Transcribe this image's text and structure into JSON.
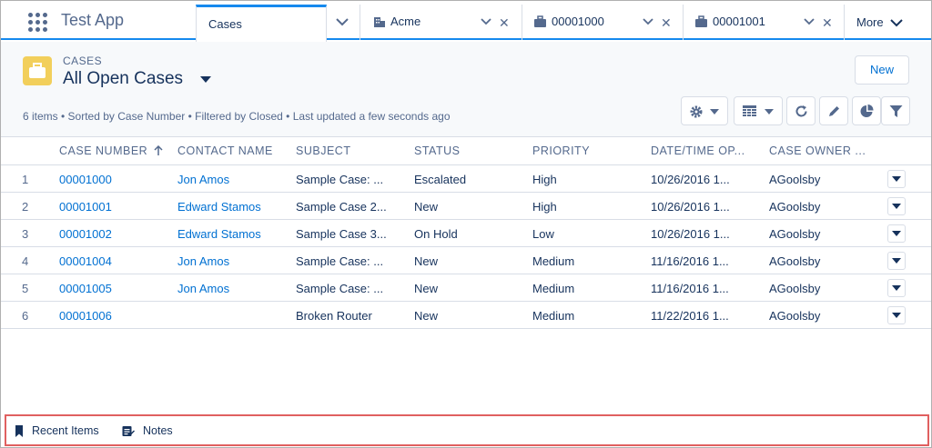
{
  "app": {
    "name": "Test App"
  },
  "tabs": [
    {
      "label": "Cases"
    },
    {
      "label": "Acme"
    },
    {
      "label": "00001000"
    },
    {
      "label": "00001001"
    }
  ],
  "more_label": "More",
  "header": {
    "object_label": "CASES",
    "list_view": "All Open Cases",
    "new_button": "New",
    "meta": "6 items • Sorted by Case Number • Filtered by Closed • Last updated a few seconds ago"
  },
  "table": {
    "columns": [
      "CASE NUMBER",
      "CONTACT NAME",
      "SUBJECT",
      "STATUS",
      "PRIORITY",
      "DATE/TIME OP...",
      "CASE OWNER ..."
    ],
    "rows": [
      {
        "num": "1",
        "case": "00001000",
        "contact": "Jon Amos",
        "subject": "Sample Case: ...",
        "status": "Escalated",
        "priority": "High",
        "date": "10/26/2016 1...",
        "owner": "AGoolsby"
      },
      {
        "num": "2",
        "case": "00001001",
        "contact": "Edward Stamos",
        "subject": "Sample Case 2...",
        "status": "New",
        "priority": "High",
        "date": "10/26/2016 1...",
        "owner": "AGoolsby"
      },
      {
        "num": "3",
        "case": "00001002",
        "contact": "Edward Stamos",
        "subject": "Sample Case 3...",
        "status": "On Hold",
        "priority": "Low",
        "date": "10/26/2016 1...",
        "owner": "AGoolsby"
      },
      {
        "num": "4",
        "case": "00001004",
        "contact": "Jon Amos",
        "subject": "Sample Case: ...",
        "status": "New",
        "priority": "Medium",
        "date": "11/16/2016 1...",
        "owner": "AGoolsby"
      },
      {
        "num": "5",
        "case": "00001005",
        "contact": "Jon Amos",
        "subject": "Sample Case: ...",
        "status": "New",
        "priority": "Medium",
        "date": "11/16/2016 1...",
        "owner": "AGoolsby"
      },
      {
        "num": "6",
        "case": "00001006",
        "contact": "",
        "subject": "Broken Router",
        "status": "New",
        "priority": "Medium",
        "date": "11/22/2016 1...",
        "owner": "AGoolsby"
      }
    ]
  },
  "utility_bar": {
    "items": [
      {
        "label": "Recent Items",
        "icon": "bookmark-icon"
      },
      {
        "label": "Notes",
        "icon": "notes-icon"
      }
    ]
  },
  "colors": {
    "brand": "#1589ee",
    "link": "#0070d2",
    "case_icon": "#f2cf5b",
    "highlight": "#e06060"
  }
}
